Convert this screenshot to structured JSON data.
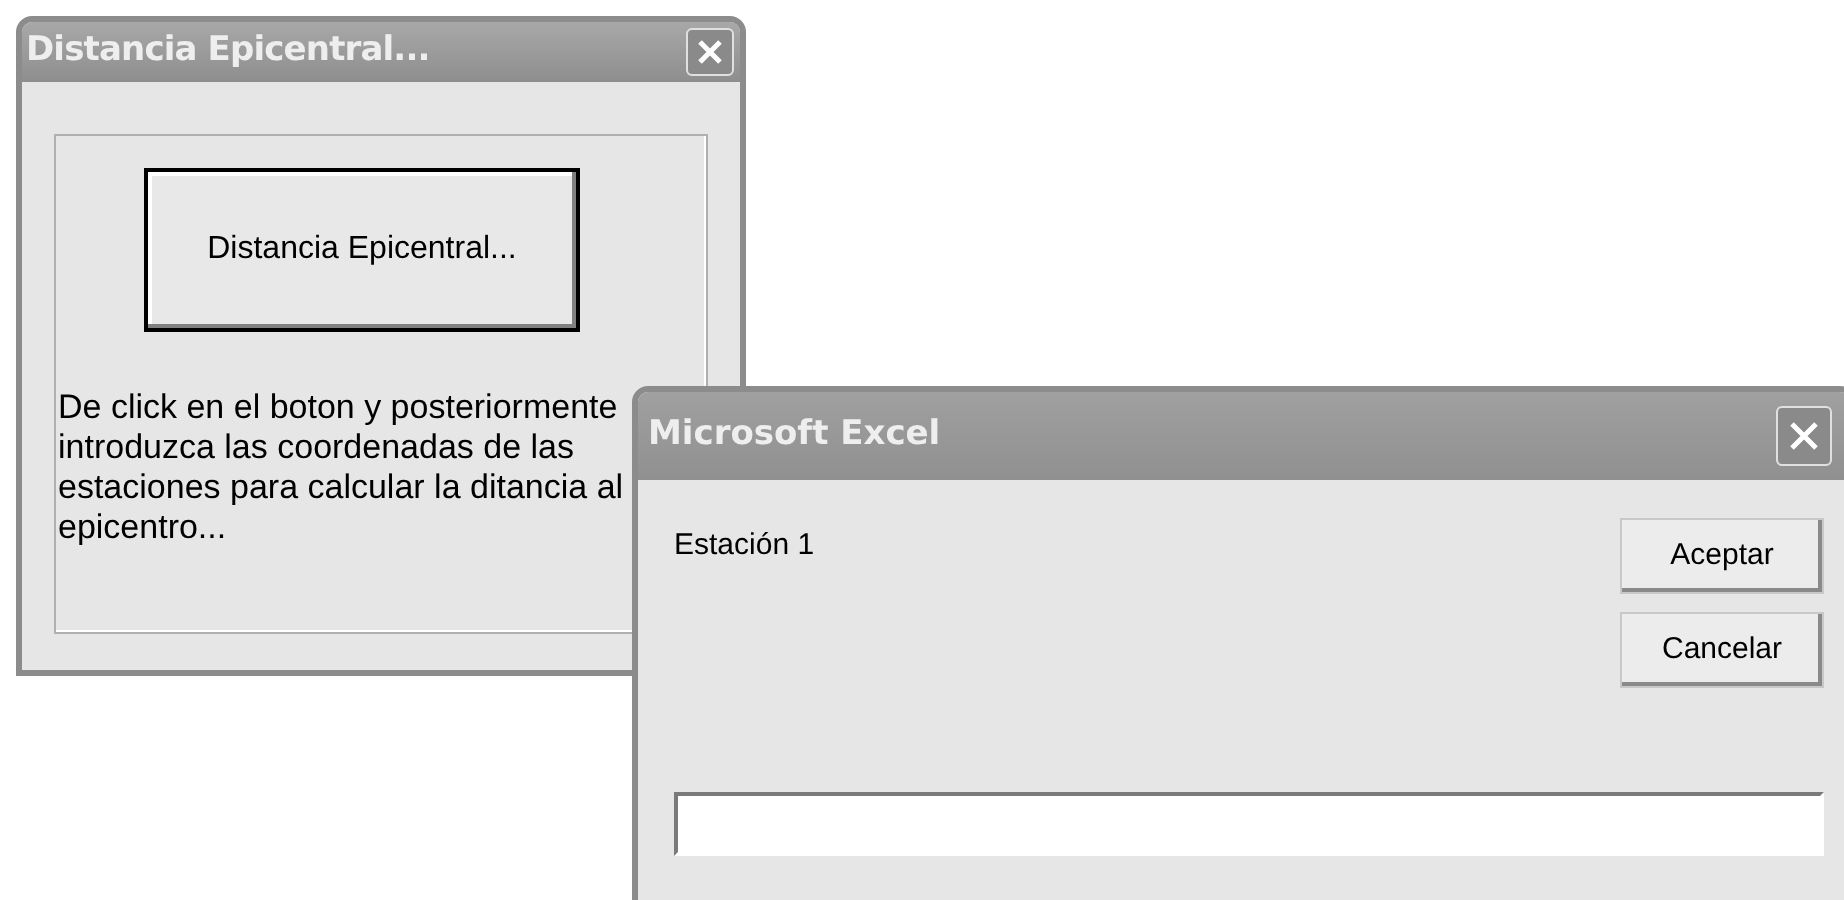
{
  "windows": [
    {
      "title": "Distancia Epicentral...",
      "button": "Distancia Epicentral...",
      "message": "De click en el boton y posteriormente introduzca las coordenadas de las estaciones para calcular la ditancia al epicentro..."
    },
    {
      "title": "Microsoft Excel",
      "prompt": "Estación 1",
      "buttons": [
        "Aceptar",
        "Cancelar"
      ]
    }
  ]
}
